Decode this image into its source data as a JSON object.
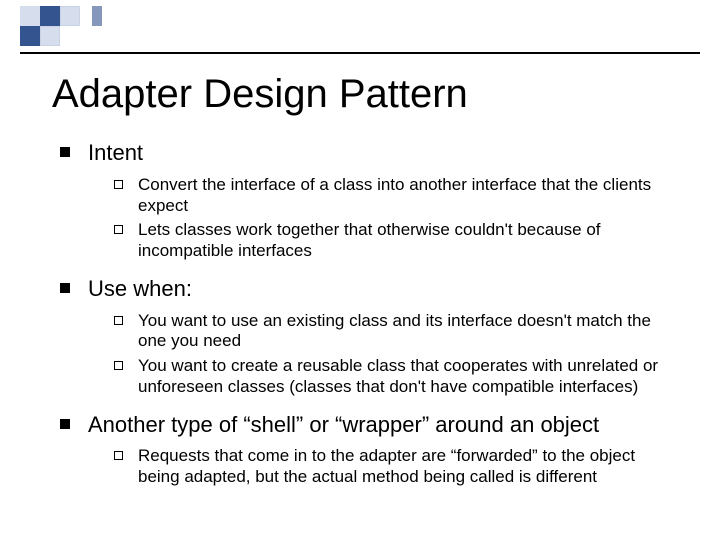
{
  "title": "Adapter Design Pattern",
  "sections": [
    {
      "heading": "Intent",
      "items": [
        "Convert the interface of a class into another interface that the clients expect",
        "Lets classes work together that otherwise couldn't because of incompatible interfaces"
      ]
    },
    {
      "heading": "Use when:",
      "items": [
        "You want to use an existing class and its interface doesn't match the one you need",
        "You want to create a reusable class that cooperates with unrelated or unforeseen classes (classes that don't have compatible interfaces)"
      ]
    },
    {
      "heading": "Another type of “shell” or “wrapper” around an object",
      "items": [
        "Requests that come in to the adapter are “forwarded” to the object being adapted, but the actual method being called is different"
      ]
    }
  ]
}
